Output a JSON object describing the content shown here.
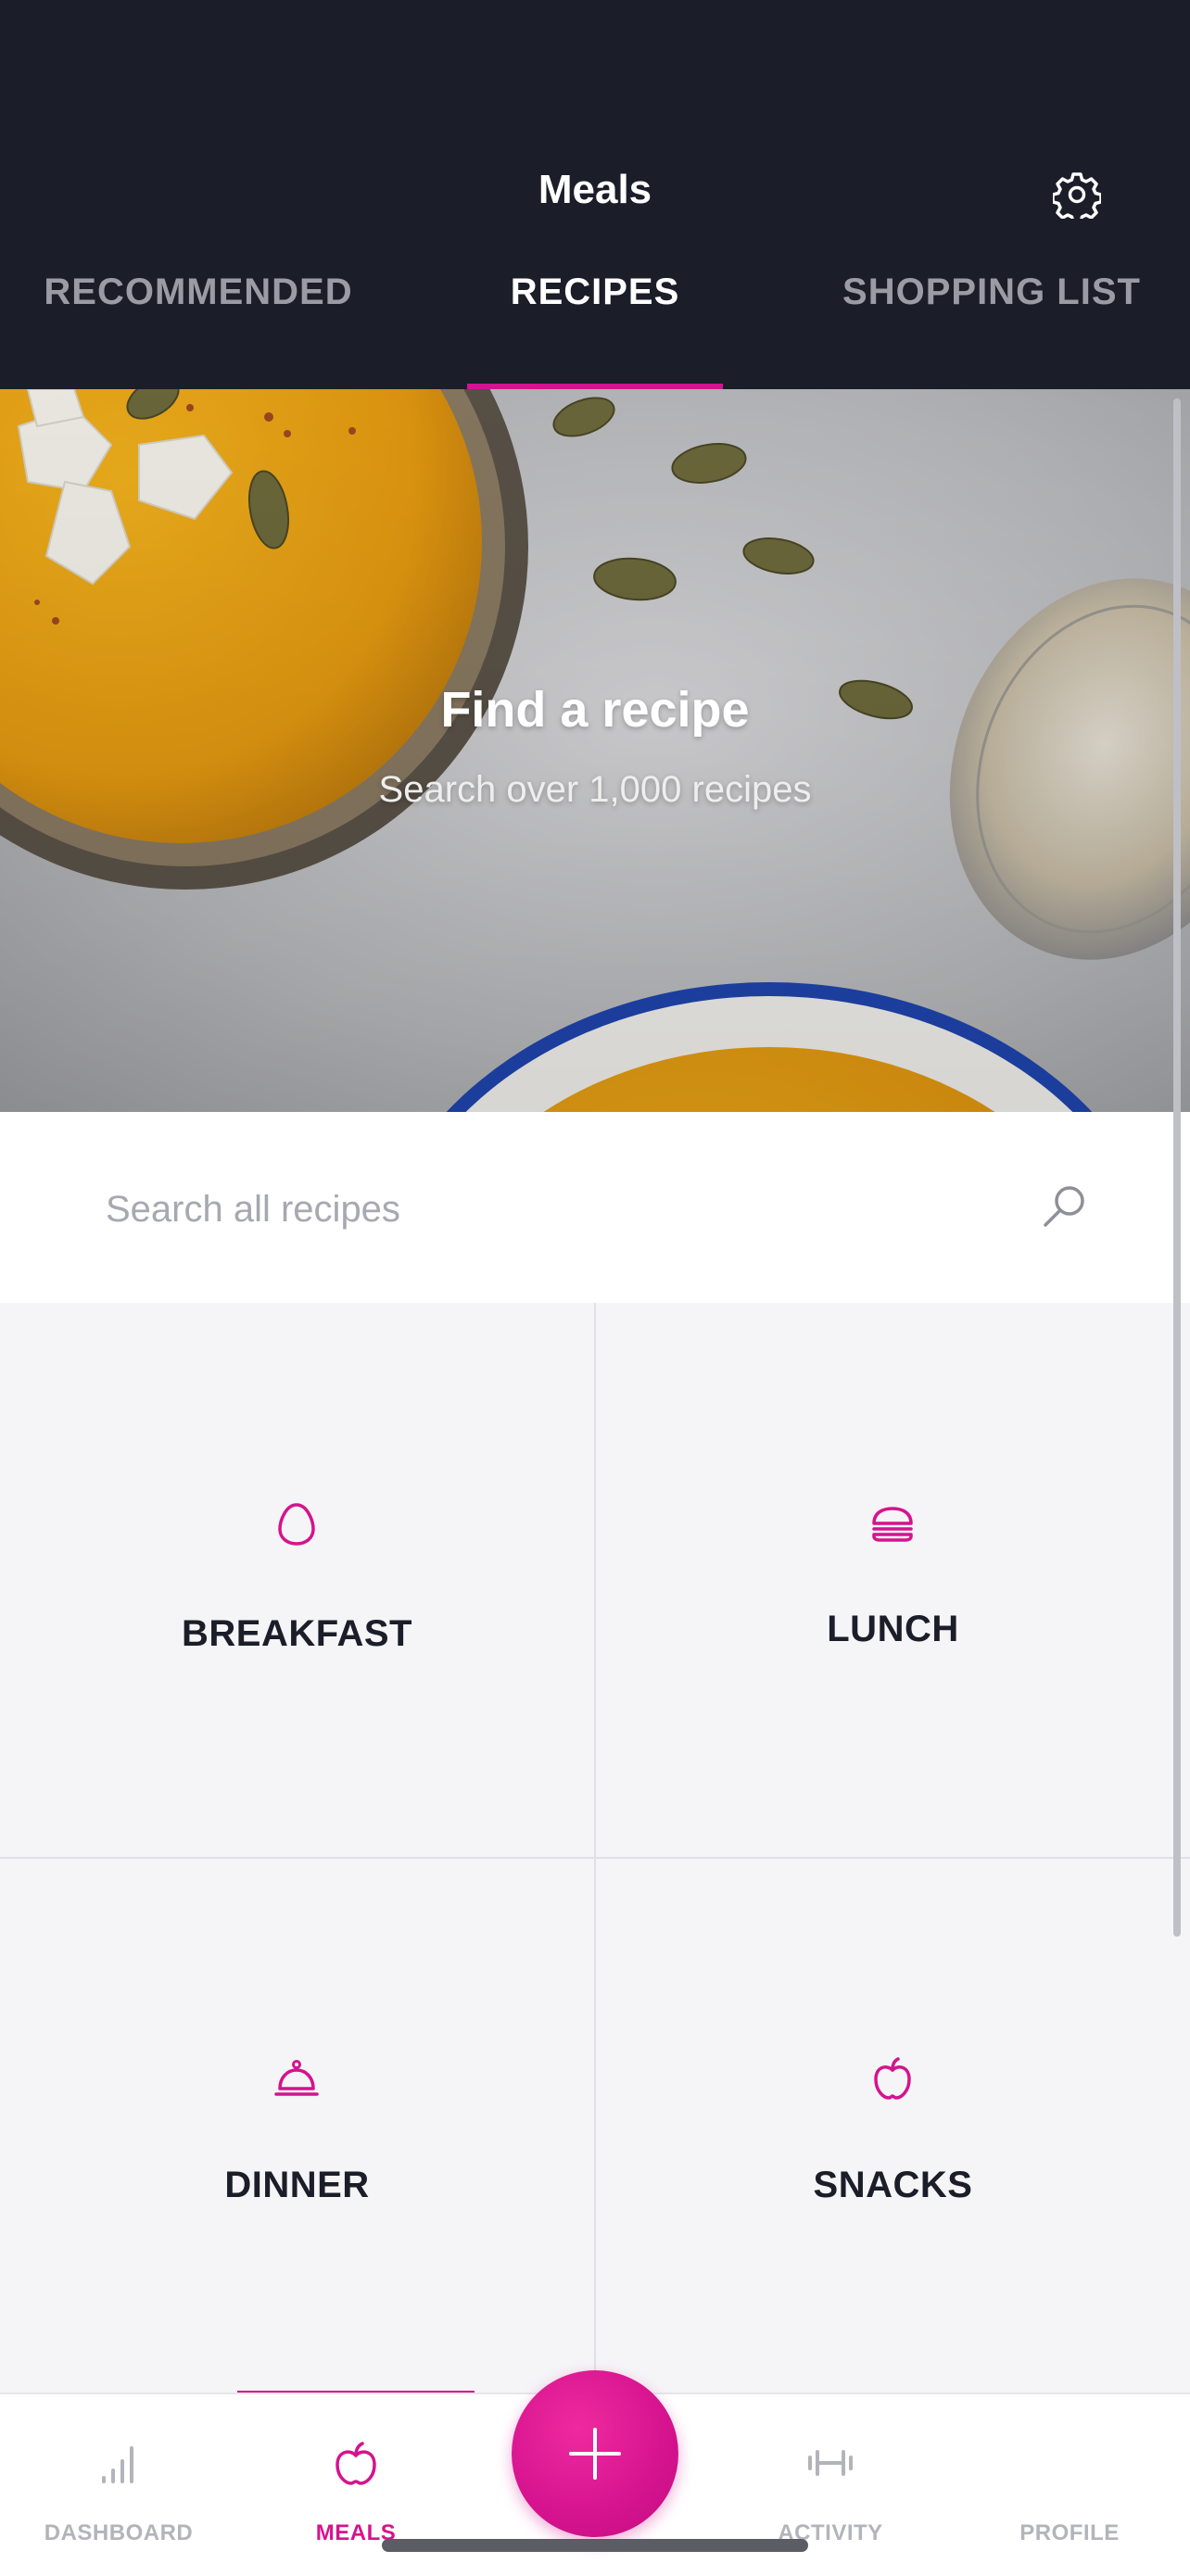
{
  "header": {
    "title": "Meals",
    "tabs": [
      {
        "label": "RECOMMENDED",
        "active": false
      },
      {
        "label": "RECIPES",
        "active": true
      },
      {
        "label": "SHOPPING LIST",
        "active": false
      }
    ]
  },
  "hero": {
    "title": "Find a recipe",
    "subtitle": "Search over 1,000 recipes"
  },
  "search": {
    "placeholder": "Search all recipes"
  },
  "categories": [
    {
      "label": "BREAKFAST",
      "icon": "egg-icon"
    },
    {
      "label": "LUNCH",
      "icon": "burger-icon"
    },
    {
      "label": "DINNER",
      "icon": "cloche-icon"
    },
    {
      "label": "SNACKS",
      "icon": "apple-icon"
    }
  ],
  "bottom_nav": {
    "items": [
      {
        "label": "DASHBOARD",
        "icon": "bar-chart-icon",
        "active": false
      },
      {
        "label": "MEALS",
        "icon": "apple-icon",
        "active": true
      },
      {
        "label": "ACTIVITY",
        "icon": "dumbbell-icon",
        "active": false
      },
      {
        "label": "PROFILE",
        "icon": "",
        "active": false
      }
    ],
    "fab_icon": "plus-icon"
  },
  "colors": {
    "accent": "#d5138e",
    "header_bg": "#1b1d29",
    "tab_inactive": "#9a9ba5",
    "grid_bg": "#f5f5f7",
    "nav_inactive": "#b3b4bb"
  }
}
